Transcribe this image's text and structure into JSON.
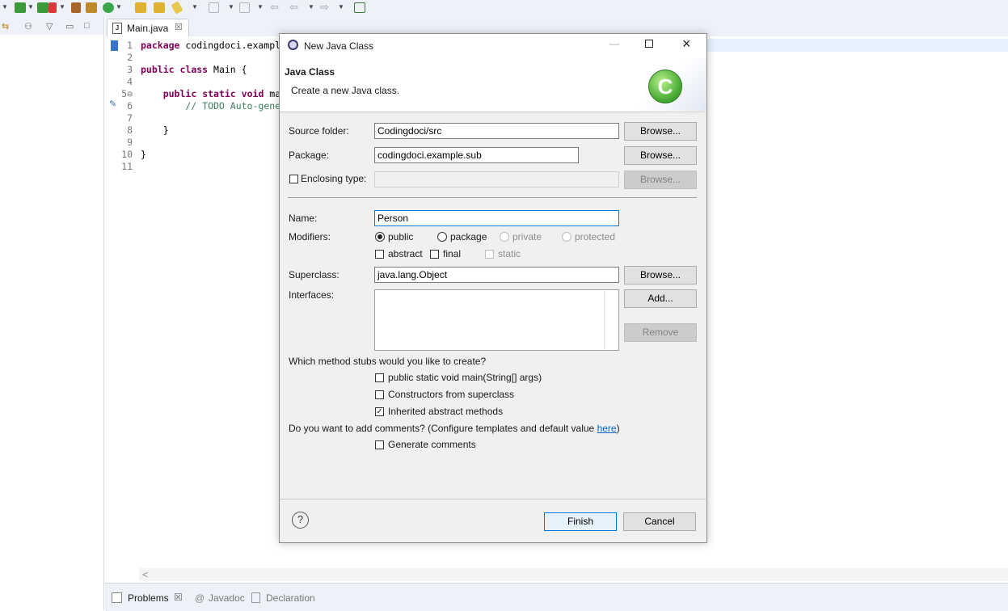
{
  "editor": {
    "tab_label": "Main.java",
    "code_lines": [
      {
        "num": "1",
        "tokens": [
          {
            "t": "package",
            "k": "kw"
          },
          {
            "t": " codingdoci.exampl",
            "k": ""
          }
        ]
      },
      {
        "num": "2",
        "tokens": []
      },
      {
        "num": "3",
        "tokens": [
          {
            "t": "public",
            "k": "kw"
          },
          {
            "t": " ",
            "k": ""
          },
          {
            "t": "class",
            "k": "kw"
          },
          {
            "t": " Main {",
            "k": ""
          }
        ]
      },
      {
        "num": "4",
        "tokens": []
      },
      {
        "num": "5⊖",
        "tokens": [
          {
            "t": "    ",
            "k": ""
          },
          {
            "t": "public",
            "k": "kw"
          },
          {
            "t": " ",
            "k": ""
          },
          {
            "t": "static",
            "k": "kw"
          },
          {
            "t": " ",
            "k": ""
          },
          {
            "t": "void",
            "k": "kw"
          },
          {
            "t": " ma",
            "k": ""
          }
        ]
      },
      {
        "num": "6",
        "tokens": [
          {
            "t": "        // TODO Auto-gene",
            "k": "cm"
          }
        ]
      },
      {
        "num": "7",
        "tokens": []
      },
      {
        "num": "8",
        "tokens": [
          {
            "t": "    }",
            "k": ""
          }
        ]
      },
      {
        "num": "9",
        "tokens": []
      },
      {
        "num": "10",
        "tokens": [
          {
            "t": "}",
            "k": ""
          }
        ]
      },
      {
        "num": "11",
        "tokens": []
      }
    ],
    "scroll_left_arrow": "<"
  },
  "bottom_panel": {
    "tabs": [
      {
        "label": "Problems",
        "close": "☒"
      },
      {
        "label": "Javadoc"
      },
      {
        "label": "Declaration"
      }
    ]
  },
  "dialog": {
    "title": "New Java Class",
    "heading": "Java Class",
    "description": "Create a new Java class.",
    "labels": {
      "source_folder": "Source folder:",
      "package": "Package:",
      "enclosing_type": "Enclosing type:",
      "name": "Name:",
      "modifiers": "Modifiers:",
      "superclass": "Superclass:",
      "interfaces": "Interfaces:"
    },
    "values": {
      "source_folder": "Codingdoci/src",
      "package": "codingdoci.example.sub",
      "enclosing_type": "",
      "name": "Person",
      "superclass": "java.lang.Object"
    },
    "buttons": {
      "browse": "Browse...",
      "add": "Add...",
      "remove": "Remove",
      "finish": "Finish",
      "cancel": "Cancel"
    },
    "modifiers": {
      "public": "public",
      "package": "package",
      "private": "private",
      "protected": "protected",
      "abstract": "abstract",
      "final": "final",
      "static": "static"
    },
    "stubs_question": "Which method stubs would you like to create?",
    "stubs": {
      "main": "public static void main(String[] args)",
      "constructors": "Constructors from superclass",
      "inherited": "Inherited abstract methods"
    },
    "comments_question_prefix": "Do you want to add comments? (Configure templates and default value ",
    "comments_link": "here",
    "comments_question_suffix": ")",
    "generate_comments": "Generate comments",
    "help_symbol": "?"
  },
  "colors": {
    "accent": "#0078d7",
    "keyword": "#7f0055",
    "comment": "#3f7f5f"
  }
}
